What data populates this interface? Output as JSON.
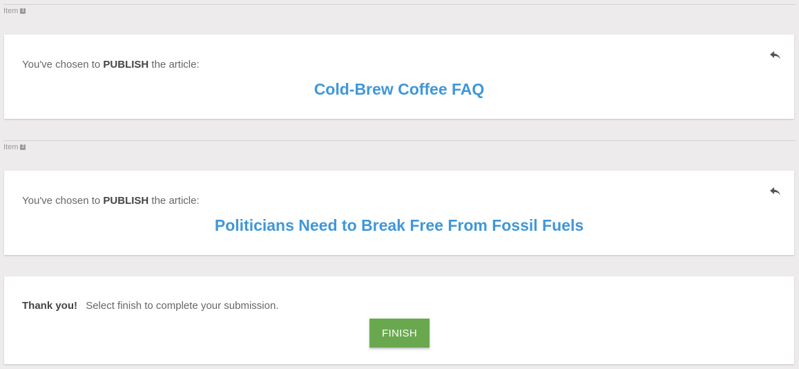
{
  "items": [
    {
      "item_label": "Item",
      "item_number": "1",
      "prefix": "You've chosen to",
      "action": "PUBLISH",
      "suffix": "the article:",
      "title": "Cold-Brew Coffee FAQ",
      "undo_icon": "undo-arrow-icon"
    },
    {
      "item_label": "Item",
      "item_number": "2",
      "prefix": "You've chosen to",
      "action": "PUBLISH",
      "suffix": "the article:",
      "title": "Politicians Need to Break Free From Fossil Fuels",
      "undo_icon": "undo-arrow-icon"
    }
  ],
  "finish": {
    "thank_you": "Thank you!",
    "message": "Select finish to complete your submission.",
    "button_label": "FINISH",
    "button_color": "#6aa84f"
  },
  "colors": {
    "title": "#3f97d9",
    "background": "#edebeb"
  }
}
